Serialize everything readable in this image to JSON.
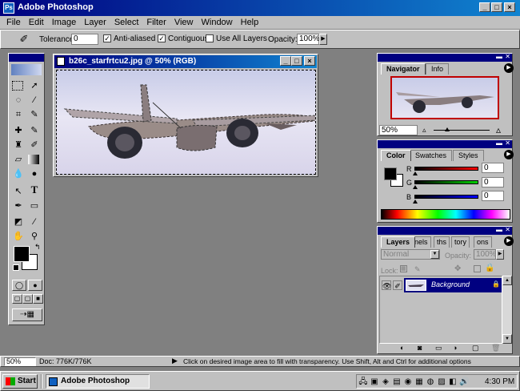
{
  "app": {
    "title": "Adobe Photoshop"
  },
  "menu": [
    "File",
    "Edit",
    "Image",
    "Layer",
    "Select",
    "Filter",
    "View",
    "Window",
    "Help"
  ],
  "options": {
    "tolerance_label": "Tolerance:",
    "tolerance_value": "0",
    "anti_aliased_label": "Anti-aliased",
    "contiguous_label": "Contiguous",
    "use_all_layers_label": "Use All Layers",
    "opacity_label": "Opacity:",
    "opacity_value": "100%"
  },
  "document": {
    "title": "b26c_starfrtcu2.jpg @ 50% (RGB)"
  },
  "navigator": {
    "tabs": [
      "Navigator",
      "Info"
    ],
    "zoom": "50%"
  },
  "color": {
    "tabs": [
      "Color",
      "Swatches",
      "Styles"
    ],
    "r_label": "R",
    "g_label": "G",
    "b_label": "B",
    "r_value": "0",
    "g_value": "0",
    "b_value": "0",
    "r_color": "#c00000",
    "g_color": "#00a000",
    "b_color": "#0000c0"
  },
  "layers": {
    "tabs": [
      "Layers",
      "nels",
      "ths",
      "tory",
      "ons"
    ],
    "blend_mode": "Normal",
    "opacity_label": "Opacity:",
    "opacity_value": "100%",
    "lock_label": "Lock:",
    "layer_name": "Background"
  },
  "status": {
    "zoom": "50%",
    "doc": "Doc: 776K/776K",
    "hint": "Click on desired image area to fill with transparency.  Use Shift, Alt and Ctrl for additional options"
  },
  "taskbar": {
    "start": "Start",
    "task": "Adobe Photoshop",
    "time": "4:30 PM"
  }
}
